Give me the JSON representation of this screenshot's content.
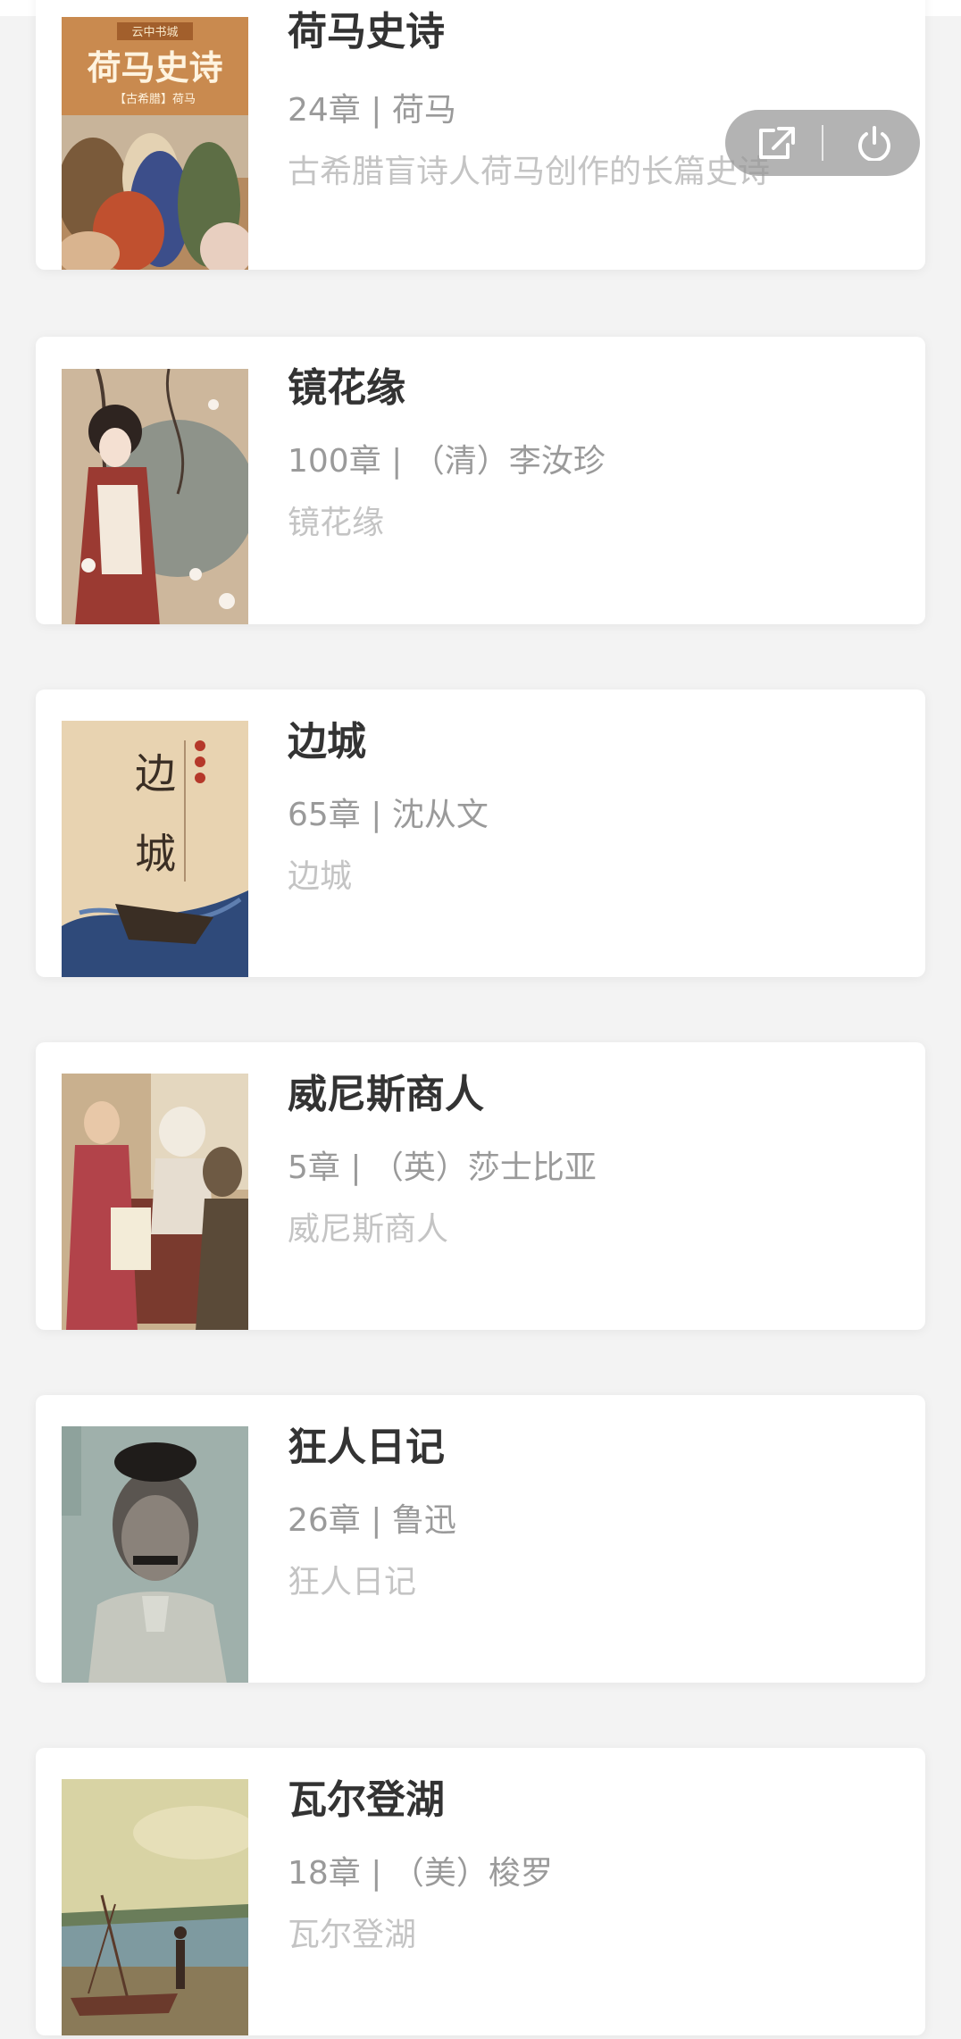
{
  "books": [
    {
      "title": "荷马史诗",
      "meta": "24章 | 荷马",
      "desc": "古希腊盲诗人荷马创作的长篇史诗",
      "cover_text": {
        "series": "云中书城",
        "title": "荷马史诗",
        "subtitle": "【古希腊】荷马"
      }
    },
    {
      "title": "镜花缘",
      "meta": "100章 | （清）李汝珍",
      "desc": "镜花缘"
    },
    {
      "title": "边城",
      "meta": "65章 | 沈从文",
      "desc": "边城",
      "cover_text": {
        "title_char_1": "边",
        "title_char_2": "城"
      }
    },
    {
      "title": "威尼斯商人",
      "meta": "5章 | （英）莎士比亚",
      "desc": "威尼斯商人"
    },
    {
      "title": "狂人日记",
      "meta": "26章 | 鲁迅",
      "desc": "狂人日记"
    },
    {
      "title": "瓦尔登湖",
      "meta": "18章 | （美）梭罗",
      "desc": "瓦尔登湖"
    }
  ],
  "capsule": {
    "share_icon": "share-external-icon",
    "close_icon": "power-icon"
  },
  "colors": {
    "title": "#333333",
    "meta": "#9a9a9a",
    "desc": "#c4c4c4",
    "page_bg": "#f3f3f3",
    "card_bg": "#ffffff"
  }
}
